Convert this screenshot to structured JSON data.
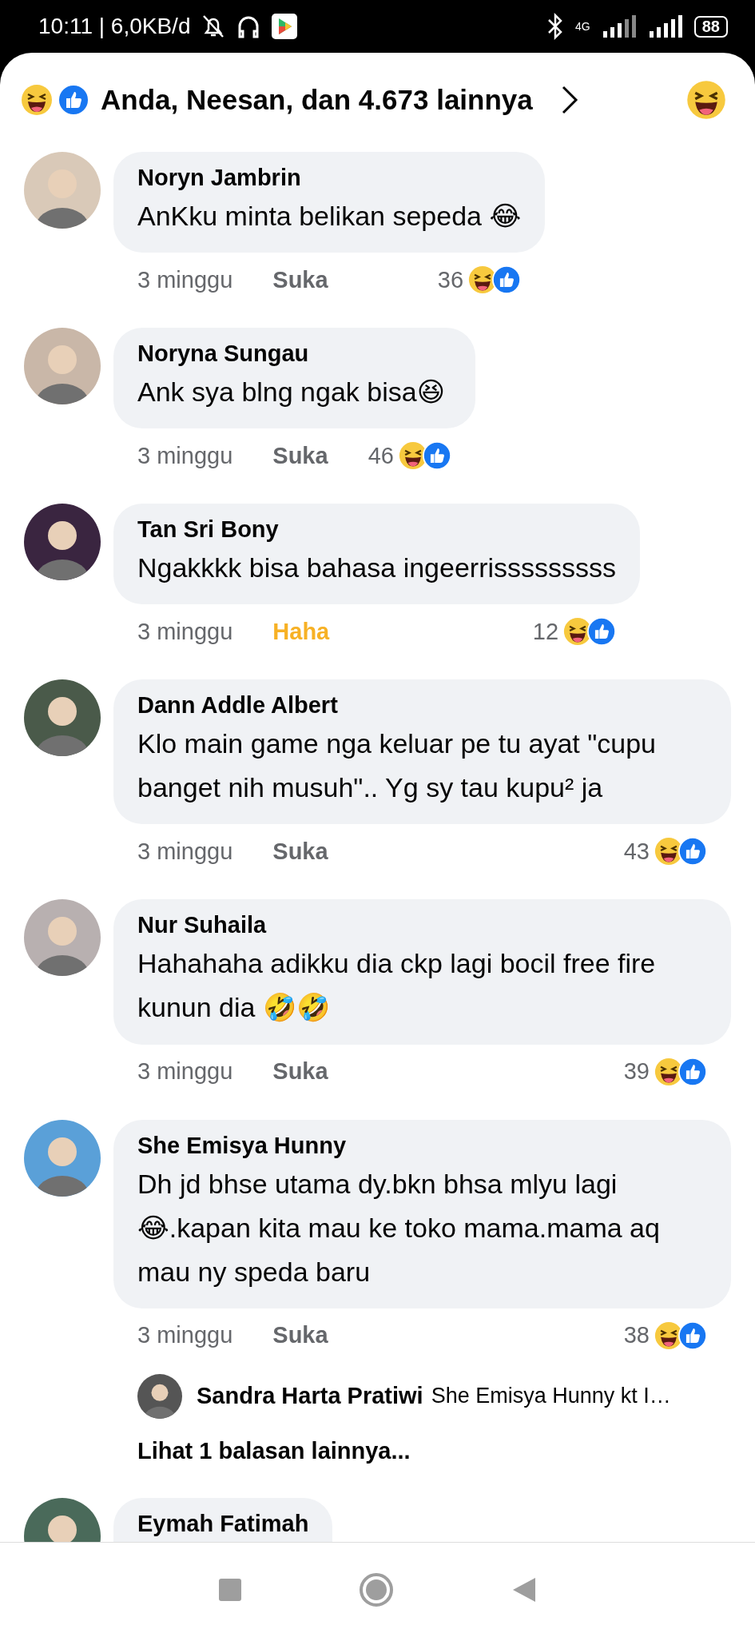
{
  "status_bar": {
    "time": "10:11 | 6,0KB/d",
    "network": "4G",
    "battery": "88"
  },
  "header": {
    "reactors": "Anda, Neesan, dan 4.673 lainnya"
  },
  "comments": [
    {
      "name": "Noryn Jambrin",
      "text": "AnKku minta belikan sepeda 😂",
      "time": "3 minggu",
      "action": "Suka",
      "reacted": false,
      "count": "36"
    },
    {
      "name": "Noryna Sungau",
      "text": "Ank sya blng ngak bisa😆",
      "time": "3 minggu",
      "action": "Suka",
      "reacted": false,
      "count": "46"
    },
    {
      "name": "Tan Sri Bony",
      "text": "Ngakkkk bisa bahasa ingeerrisssssssss",
      "time": "3 minggu",
      "action": "Haha",
      "reacted": true,
      "count": "12"
    },
    {
      "name": "Dann Addle Albert",
      "text": "Klo main game nga keluar pe tu ayat \"cupu banget nih musuh\".. Yg sy tau kupu² ja",
      "time": "3 minggu",
      "action": "Suka",
      "reacted": false,
      "count": "43"
    },
    {
      "name": "Nur Suhaila",
      "text": "Hahahaha adikku dia ckp lagi bocil free fire kunun dia 🤣🤣",
      "time": "3 minggu",
      "action": "Suka",
      "reacted": false,
      "count": "39"
    },
    {
      "name": "She Emisya Hunny",
      "text": "Dh jd bhse utama dy.bkn bhsa mlyu lagi 😂.kapan kita mau ke toko mama.mama aq mau ny speda baru",
      "time": "3 minggu",
      "action": "Suka",
      "reacted": false,
      "count": "38",
      "replies": [
        {
          "name": "Sandra Harta Pratiwi",
          "text": "She Emisya Hunny kt I…"
        }
      ],
      "more_replies": "Lihat 1 balasan lainnya..."
    },
    {
      "name": "Eymah Fatimah"
    }
  ]
}
